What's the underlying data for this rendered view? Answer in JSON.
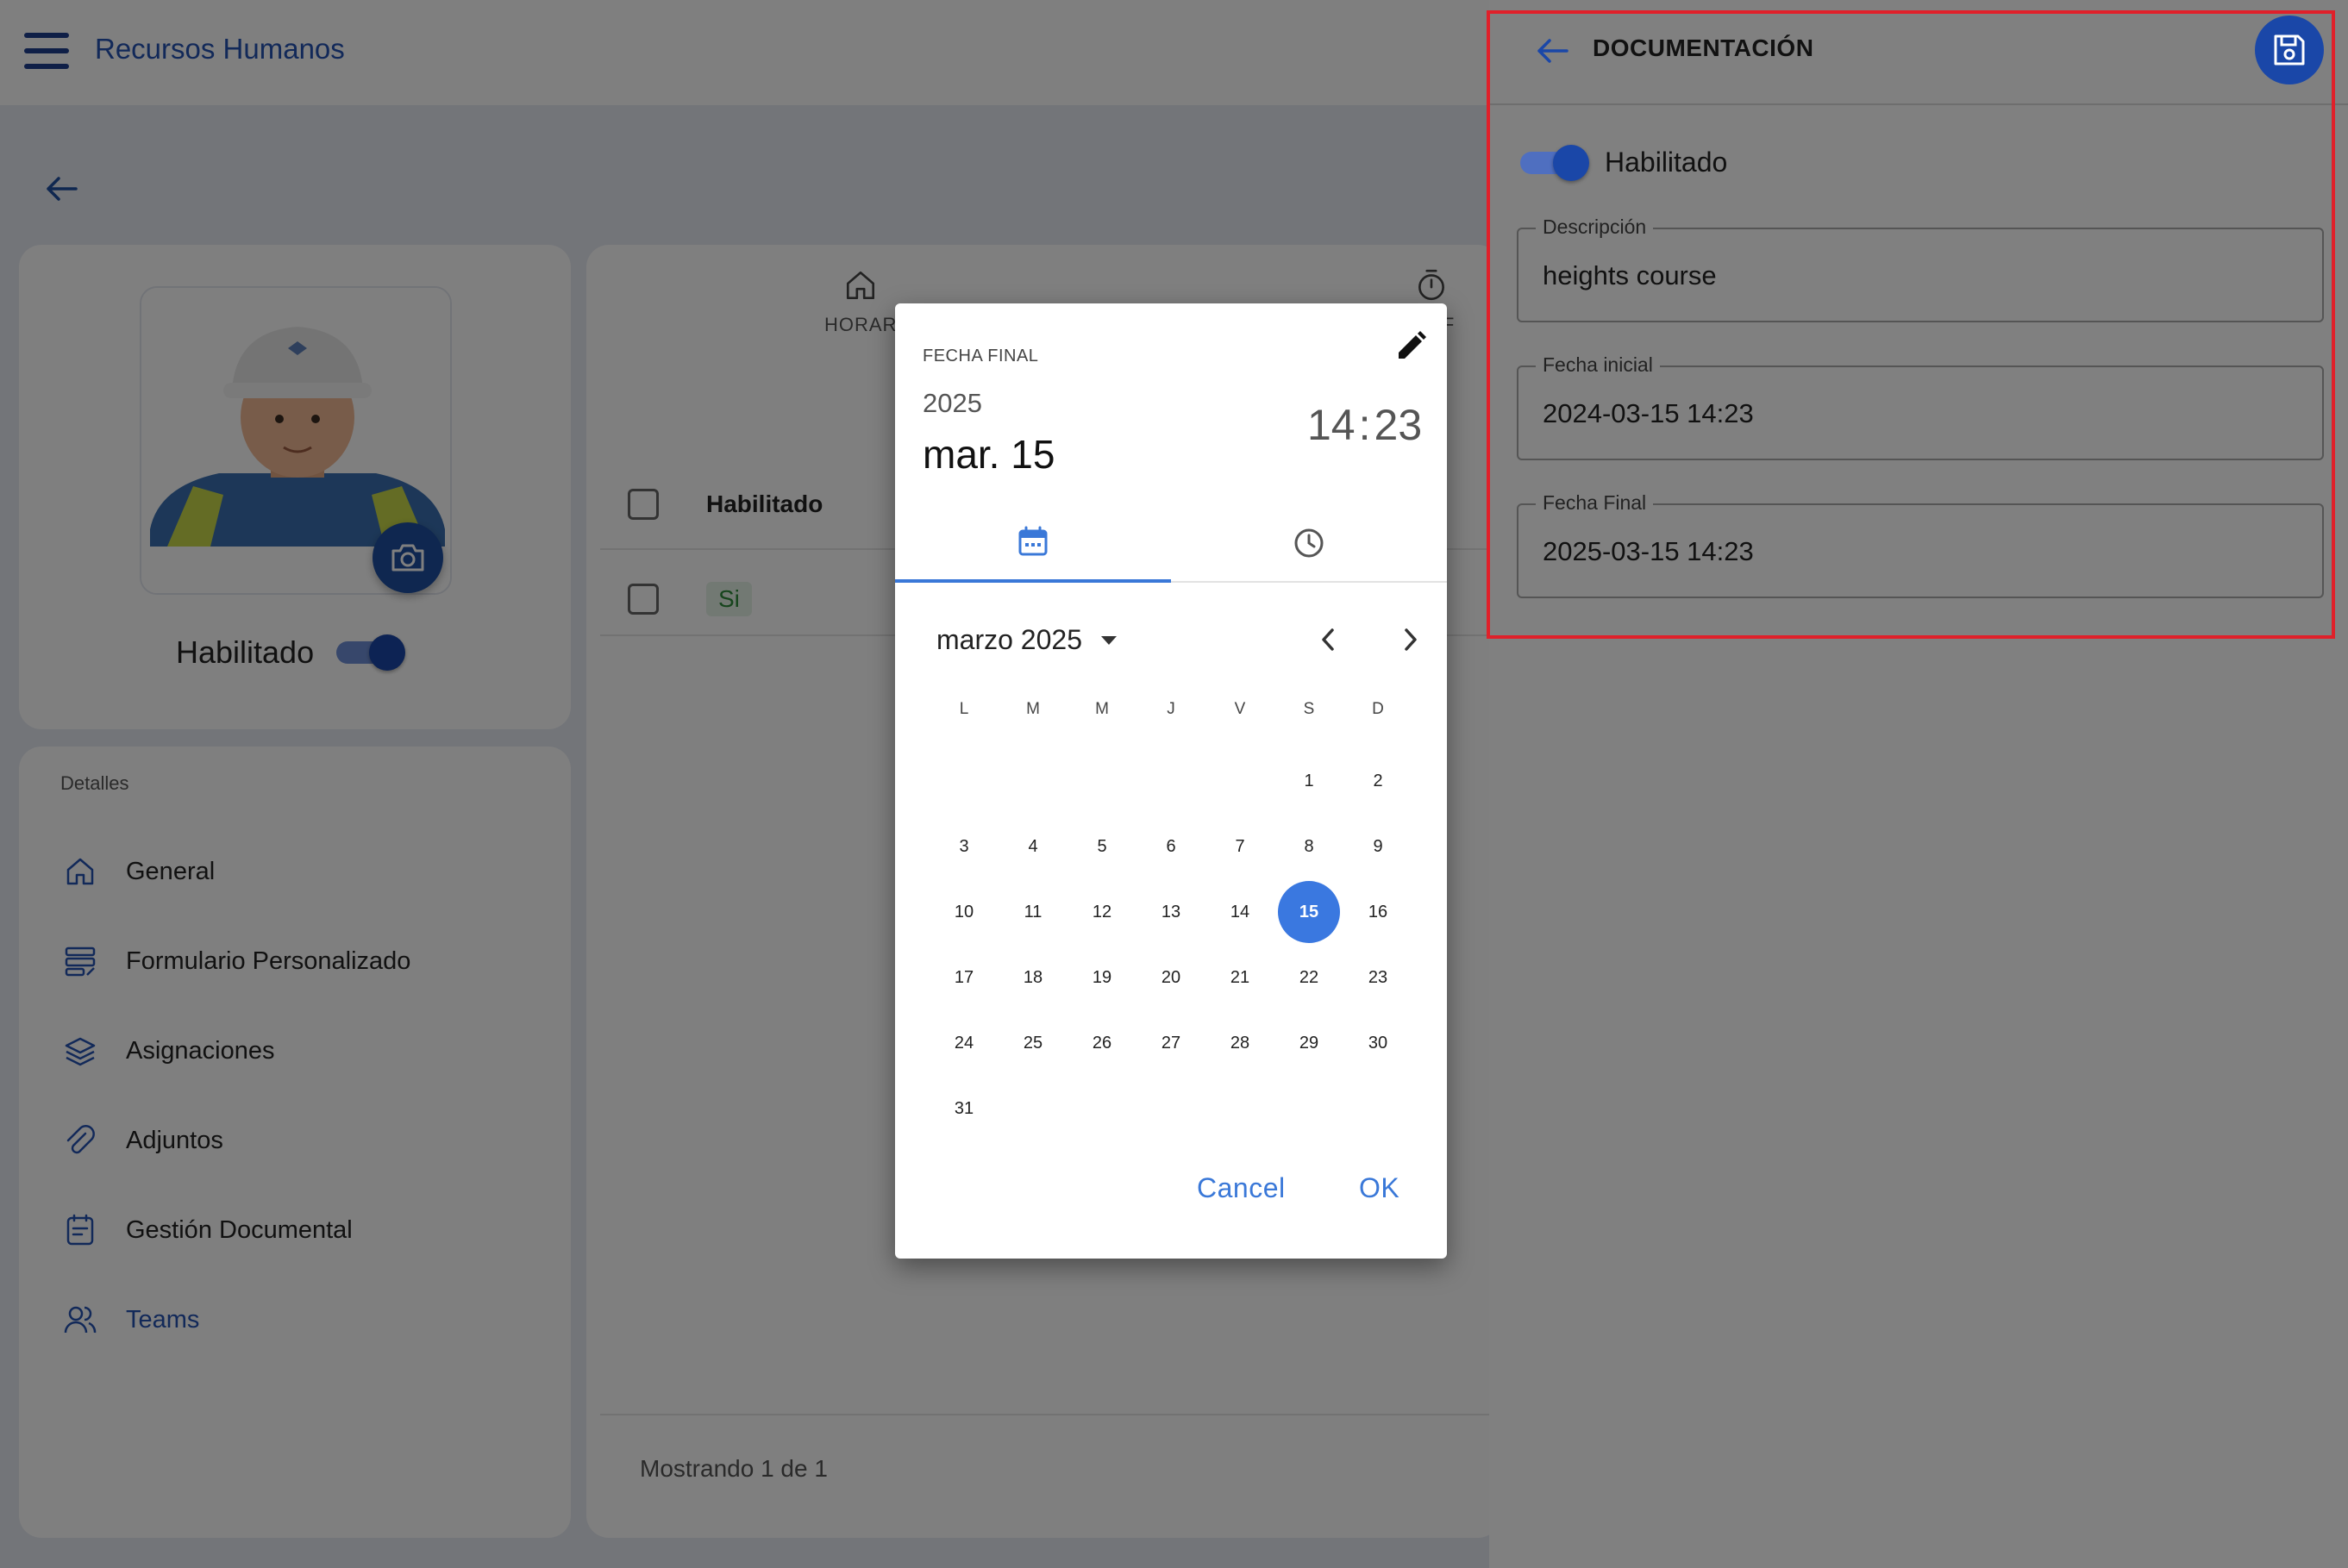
{
  "app": {
    "title": "Recursos Humanos"
  },
  "profile": {
    "enabled_label": "Habilitado"
  },
  "details": {
    "title": "Detalles",
    "items": [
      {
        "label": "General",
        "icon": "home-icon"
      },
      {
        "label": "Formulario Personalizado",
        "icon": "form-icon"
      },
      {
        "label": "Asignaciones",
        "icon": "layers-icon"
      },
      {
        "label": "Adjuntos",
        "icon": "attachment-icon"
      },
      {
        "label": "Gestión Documental",
        "icon": "document-icon"
      },
      {
        "label": "Teams",
        "icon": "users-icon"
      }
    ]
  },
  "table": {
    "tabs": [
      {
        "label": "HORAR",
        "icon": "home-icon"
      },
      {
        "label": "E OF",
        "icon": "timer-icon"
      }
    ],
    "header": {
      "enabled": "Habilitado"
    },
    "rows": [
      {
        "enabled": "Si"
      }
    ],
    "footer": "Mostrando 1 de 1"
  },
  "drawer": {
    "title": "DOCUMENTACIÓN",
    "enabled_label": "Habilitado",
    "fields": {
      "description": {
        "label": "Descripción",
        "value": "heights course"
      },
      "start_date": {
        "label": "Fecha inicial",
        "value": "2024-03-15 14:23"
      },
      "end_date": {
        "label": "Fecha Final",
        "value": "2025-03-15 14:23"
      }
    }
  },
  "datepicker": {
    "caption": "FECHA FINAL",
    "year": "2025",
    "date": "mar. 15",
    "hour": "14",
    "separator": ":",
    "minute": "23",
    "month_label": "marzo 2025",
    "weekdays": [
      "L",
      "M",
      "M",
      "J",
      "V",
      "S",
      "D"
    ],
    "weeks": [
      [
        "",
        "",
        "",
        "",
        "",
        "1",
        "2"
      ],
      [
        "3",
        "4",
        "5",
        "6",
        "7",
        "8",
        "9"
      ],
      [
        "10",
        "11",
        "12",
        "13",
        "14",
        "15",
        "16"
      ],
      [
        "17",
        "18",
        "19",
        "20",
        "21",
        "22",
        "23"
      ],
      [
        "24",
        "25",
        "26",
        "27",
        "28",
        "29",
        "30"
      ],
      [
        "31",
        "",
        "",
        "",
        "",
        "",
        ""
      ]
    ],
    "selected_day": "15",
    "cancel_label": "Cancel",
    "ok_label": "OK"
  },
  "colors": {
    "accent": "#3a78e0",
    "brand": "#1a47a8",
    "highlight": "#e0202a"
  }
}
